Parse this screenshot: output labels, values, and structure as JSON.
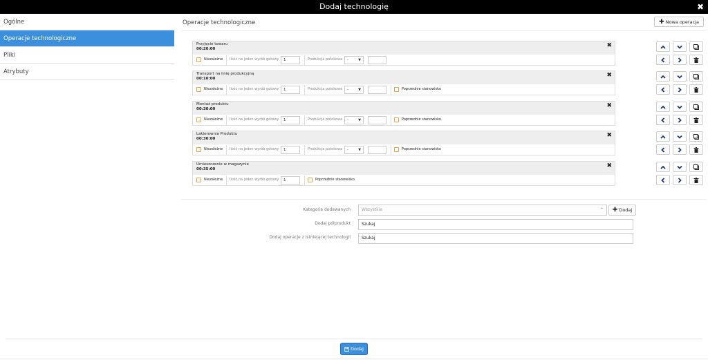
{
  "window": {
    "title": "Dodaj technologię"
  },
  "sidebar": {
    "items": [
      {
        "label": "Ogólne"
      },
      {
        "label": "Operacje technologiczne"
      },
      {
        "label": "Pliki"
      },
      {
        "label": "Atrybuty"
      }
    ],
    "active_index": 1
  },
  "main": {
    "section_title": "Operacje technologiczne",
    "new_operation_label": "Nowa operacja",
    "fields": {
      "independent": "Niezależne",
      "qty_per_product": "Ilość na jeden wyrób gotowy",
      "batch_production": "Produkcja potokowa",
      "prev_station": "Poprzednie stanowisko"
    },
    "operations": [
      {
        "name": "Przyjęcie towaru",
        "time": "00:20:00",
        "qty": "1",
        "batch": "-",
        "batch_val": ""
      },
      {
        "name": "Transport na linię produkcyjną",
        "time": "00:10:00",
        "qty": "1",
        "batch": "-",
        "batch_val": ""
      },
      {
        "name": "Montaż produktu",
        "time": "00:30:00",
        "qty": "1",
        "batch": "-",
        "batch_val": ""
      },
      {
        "name": "Lakierownia Produktu",
        "time": "00:30:00",
        "qty": "1",
        "batch": "-",
        "batch_val": ""
      },
      {
        "name": "Umieszczenie w magazynie",
        "time": "00:35:00",
        "qty": "1"
      }
    ],
    "form": {
      "category_label": "Kategoria dodawanych",
      "category_value": "Wszystkie",
      "add_label": "Dodaj",
      "semi_label": "Dodaj półprodukt",
      "semi_value": "Szukaj",
      "existing_label": "Dodaj operacje z istniejącej technologii",
      "existing_value": "Szukaj"
    }
  },
  "footer": {
    "submit_label": "Dodaj"
  }
}
